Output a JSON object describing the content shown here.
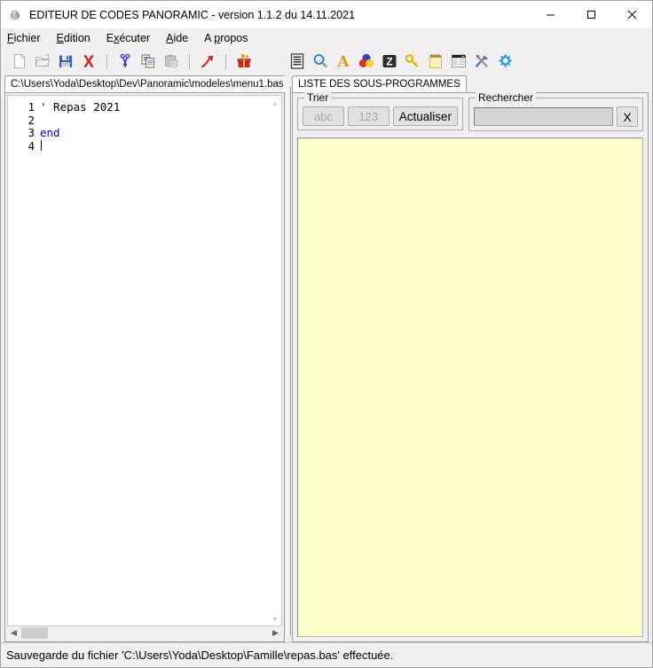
{
  "window": {
    "title": "EDITEUR DE CODES PANORAMIC - version 1.1.2 du 14.11.2021",
    "app_icon": "panoramic-app-icon",
    "controls": {
      "minimize": "minimize-icon",
      "maximize": "maximize-icon",
      "close": "close-icon"
    }
  },
  "menubar": {
    "items": [
      {
        "label": "Fichier",
        "accel": "F",
        "pre": "",
        "post": "ichier"
      },
      {
        "label": "Edition",
        "accel": "E",
        "pre": "",
        "post": "dition"
      },
      {
        "label": "Exécuter",
        "accel": "x",
        "pre": "E",
        "post": "écuter"
      },
      {
        "label": "Aide",
        "accel": "A",
        "pre": "",
        "post": "ide"
      },
      {
        "label": "A propos",
        "accel": "p",
        "pre": "A ",
        "post": "ropos"
      }
    ]
  },
  "toolbar": {
    "left_buttons": [
      {
        "name": "new-file-icon",
        "title": "Nouveau"
      },
      {
        "name": "open-file-icon",
        "title": "Ouvrir"
      },
      {
        "name": "save-file-icon",
        "title": "Enregistrer"
      },
      {
        "name": "close-file-icon",
        "title": "Fermer"
      }
    ],
    "edit_buttons": [
      {
        "name": "cut-icon",
        "title": "Couper"
      },
      {
        "name": "copy-icon",
        "title": "Copier"
      },
      {
        "name": "paste-icon",
        "title": "Coller"
      }
    ],
    "run_buttons": [
      {
        "name": "run-icon",
        "title": "Exécuter"
      }
    ],
    "gift_buttons": [
      {
        "name": "gift-box-icon",
        "title": "Cadeau"
      }
    ],
    "right_buttons": [
      {
        "name": "list-document-icon",
        "title": "Liste"
      },
      {
        "name": "search-icon",
        "title": "Rechercher"
      },
      {
        "name": "font-icon",
        "title": "Police"
      },
      {
        "name": "colors-icon",
        "title": "Couleurs"
      },
      {
        "name": "z-box-icon",
        "title": "Z"
      },
      {
        "name": "key-icon",
        "title": "Mots-clés"
      },
      {
        "name": "notepad-icon",
        "title": "Bloc-notes"
      },
      {
        "name": "window-layout-icon",
        "title": "Fenêtre"
      },
      {
        "name": "tools-icon",
        "title": "Outils"
      },
      {
        "name": "gear-icon",
        "title": "Options"
      }
    ]
  },
  "editor": {
    "tab_label": "C:\\Users\\Yoda\\Desktop\\Dev\\Panoramic\\modeles\\menu1.bas",
    "lines": [
      {
        "n": "1",
        "text": "' Repas 2021",
        "kind": "comment"
      },
      {
        "n": "2",
        "text": "",
        "kind": "plain"
      },
      {
        "n": "3",
        "text": "end",
        "kind": "keyword"
      },
      {
        "n": "4",
        "text": "",
        "kind": "caret"
      }
    ],
    "scroll": {
      "v_up": "scroll-up-arrow",
      "v_down": "scroll-down-arrow",
      "h_left": "scroll-left-arrow",
      "h_right": "scroll-right-arrow"
    }
  },
  "right_panel": {
    "tab_label": "LISTE DES SOUS-PROGRAMMES",
    "sort_group": {
      "title": "Trier",
      "buttons": [
        {
          "label": "abc",
          "enabled": false
        },
        {
          "label": "123",
          "enabled": false
        },
        {
          "label": "Actualiser",
          "enabled": true
        }
      ]
    },
    "search_group": {
      "title": "Rechercher",
      "value": "",
      "placeholder": "",
      "clear_label": "X"
    },
    "list": {
      "items": [],
      "background": "#ffffcc"
    }
  },
  "statusbar": {
    "message": "Sauvegarde du fichier 'C:\\Users\\Yoda\\Desktop\\Famille\\repas.bas' effectuée."
  },
  "colors": {
    "window_bg": "#f0f0f0",
    "editor_bg": "#ffffff",
    "list_bg": "#ffffcc",
    "keyword": "#0000e0",
    "accent_red": "#d42020",
    "accent_blue": "#3060c0"
  }
}
